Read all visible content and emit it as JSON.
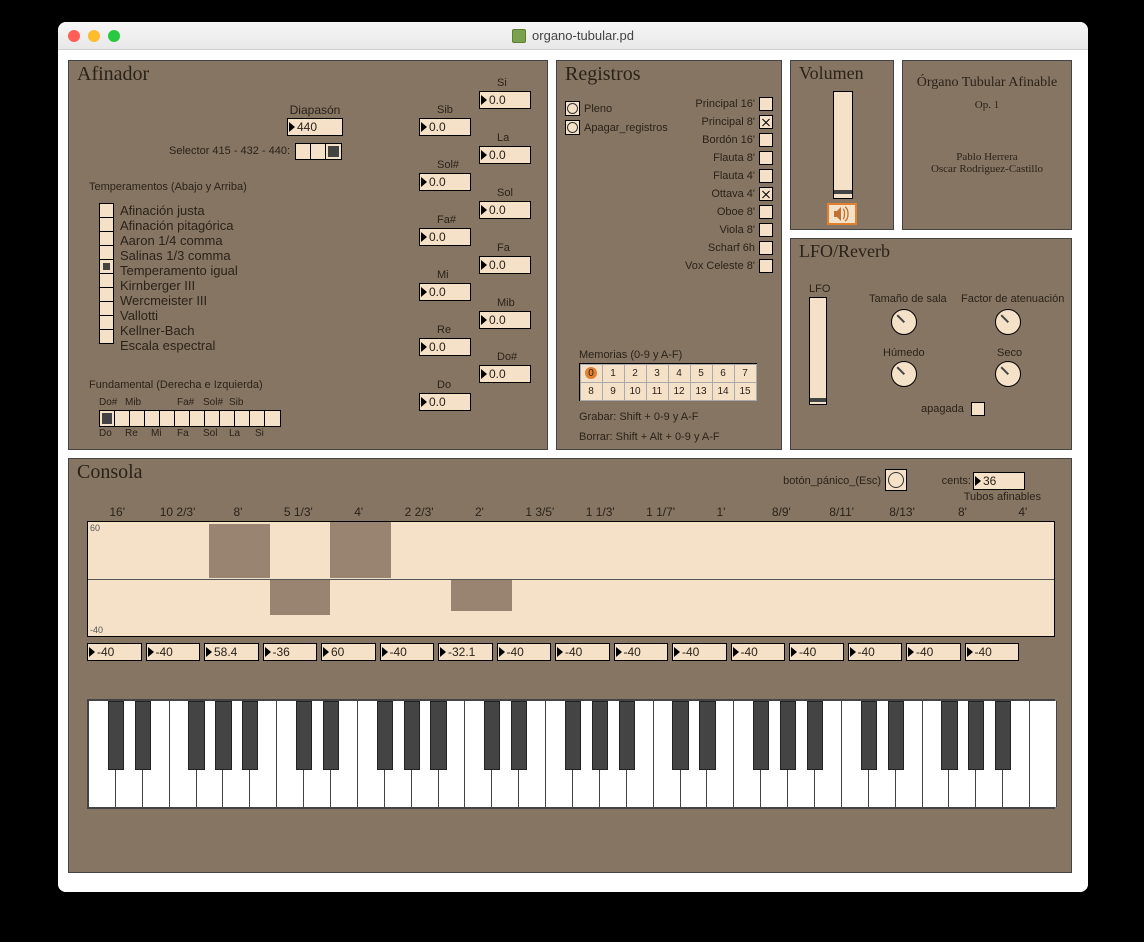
{
  "window": {
    "title": "organo-tubular.pd"
  },
  "afinador": {
    "title": "Afinador",
    "diapason_label": "Diapasón",
    "diapason_value": "440",
    "selector_label": "Selector 415 - 432 - 440:",
    "selector_sel": 2,
    "temperaments_label": "Temperamentos (Abajo y Arriba)",
    "temperaments": [
      "Afinación justa",
      "Afinación pitagórica",
      "Aaron 1/4 comma",
      "Salinas 1/3 comma",
      "Temperamento igual",
      "Kirnberger III",
      "Wercmeister III",
      "Vallotti",
      "Kellner-Bach",
      "Escala espectral"
    ],
    "temperament_sel": 4,
    "fundamental_label": "Fundamental (Derecha e Izquierda)",
    "fund_top": [
      "Do#",
      "Mib",
      "",
      "Fa#",
      "Sol#",
      "Sib",
      ""
    ],
    "fund_bot": [
      "Do",
      "Re",
      "Mi",
      "Fa",
      "Sol",
      "La",
      "Si"
    ],
    "fund_sel": 0,
    "cent_boxes": [
      {
        "note": "Si",
        "val": "0.0"
      },
      {
        "note": "Sib",
        "val": "0.0"
      },
      {
        "note": "La",
        "val": "0.0"
      },
      {
        "note": "Sol#",
        "val": "0.0"
      },
      {
        "note": "Sol",
        "val": "0.0"
      },
      {
        "note": "Fa#",
        "val": "0.0"
      },
      {
        "note": "Fa",
        "val": "0.0"
      },
      {
        "note": "Mi",
        "val": "0.0"
      },
      {
        "note": "Mib",
        "val": "0.0"
      },
      {
        "note": "Re",
        "val": "0.0"
      },
      {
        "note": "Do#",
        "val": "0.0"
      },
      {
        "note": "Do",
        "val": "0.0"
      }
    ]
  },
  "registros": {
    "title": "Registros",
    "pleno": "Pleno",
    "apagar": "Apagar_registros",
    "stops": [
      {
        "name": "Principal 16'",
        "on": false
      },
      {
        "name": "Principal 8'",
        "on": true
      },
      {
        "name": "Bordón 16'",
        "on": false
      },
      {
        "name": "Flauta 8'",
        "on": false
      },
      {
        "name": "Flauta 4'",
        "on": false
      },
      {
        "name": "Ottava 4'",
        "on": true
      },
      {
        "name": "Oboe 8'",
        "on": false
      },
      {
        "name": "Viola 8'",
        "on": false
      },
      {
        "name": "Scharf 6h",
        "on": false
      },
      {
        "name": "Vox Celeste 8'",
        "on": false
      }
    ],
    "memorias_label": "Memorias (0-9 y A-F)",
    "memorias": [
      "0",
      "1",
      "2",
      "3",
      "4",
      "5",
      "6",
      "7",
      "8",
      "9",
      "10",
      "11",
      "12",
      "13",
      "14",
      "15"
    ],
    "memorias_sel": 0,
    "grabar": "Grabar: Shift + 0-9 y A-F",
    "borrar": "Borrar: Shift + Alt + 0-9 y A-F"
  },
  "volumen": {
    "title": "Volumen",
    "level": 0.05
  },
  "credits": {
    "title": "Órgano Tubular Afinable",
    "opus": "Op. 1",
    "authors": [
      "Pablo Herrera",
      "Oscar Rodriguez-Castillo"
    ]
  },
  "lfo": {
    "title": "LFO/Reverb",
    "lfo_label": "LFO",
    "room_label": "Tamaño de sala",
    "atten_label": "Factor de atenuación",
    "wet_label": "Húmedo",
    "dry_label": "Seco",
    "apagada": "apagada"
  },
  "consola": {
    "title": "Consola",
    "panic_label": "botón_pánico_(Esc)",
    "cents_label": "cents:",
    "cents_value": "36",
    "tubos_label": "Tubos afinables",
    "harmonics": [
      "16'",
      "10 2/3'",
      "8'",
      "5 1/3'",
      "4'",
      "2 2/3'",
      "2'",
      "1 3/5'",
      "1 1/3'",
      "1 1/7'",
      "1'",
      "8/9'",
      "8/11'",
      "8/13'",
      "8'",
      "4'"
    ],
    "values": [
      "-40",
      "-40",
      "58.4",
      "-36",
      "60",
      "-40",
      "-32.1",
      "-40",
      "-40",
      "-40",
      "-40",
      "-40",
      "-40",
      "-40",
      "-40",
      "-40"
    ],
    "graph_top_label": "60",
    "graph_bot_label": "-40"
  }
}
